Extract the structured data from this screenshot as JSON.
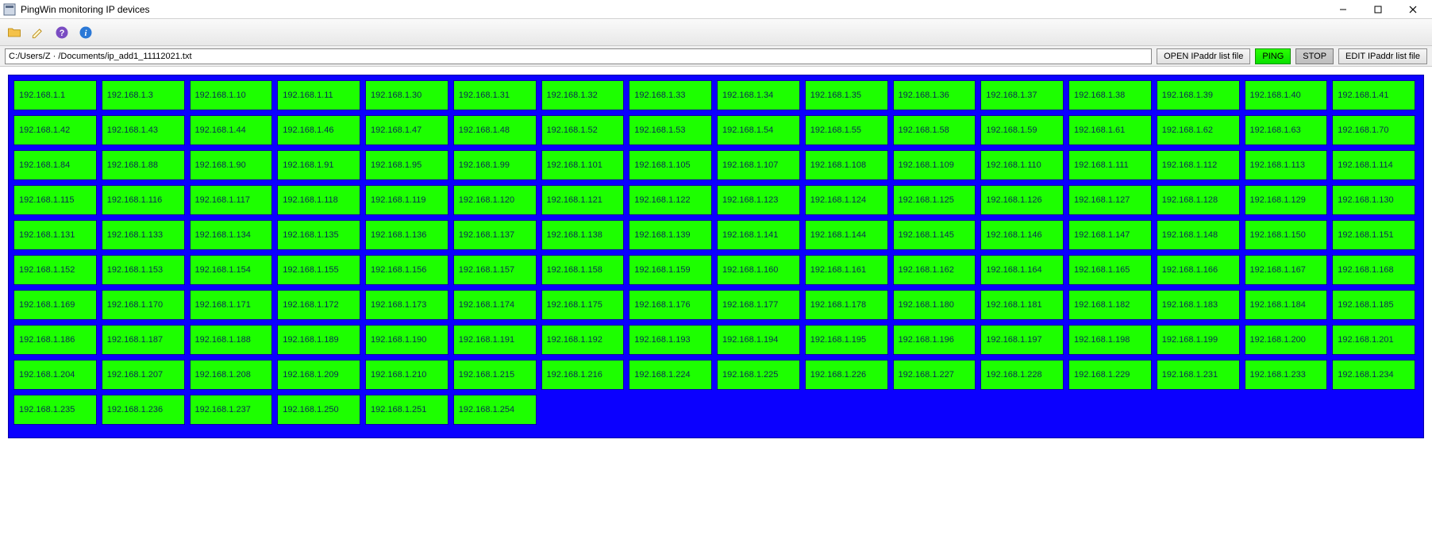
{
  "window": {
    "title": "PingWin monitoring IP devices"
  },
  "toolbar": {
    "icons": [
      "folder-icon",
      "edit-icon",
      "help-icon",
      "info-icon"
    ]
  },
  "pathrow": {
    "path": "C:/Users/Z · /Documents/ip_add1_11112021.txt",
    "open_label": "OPEN IPaddr list file",
    "ping_label": "PING",
    "stop_label": "STOP",
    "edit_label": "EDIT IPaddr list file"
  },
  "ips": [
    "192.168.1.1",
    "192.168.1.3",
    "192.168.1.10",
    "192.168.1.11",
    "192.168.1.30",
    "192.168.1.31",
    "192.168.1.32",
    "192.168.1.33",
    "192.168.1.34",
    "192.168.1.35",
    "192.168.1.36",
    "192.168.1.37",
    "192.168.1.38",
    "192.168.1.39",
    "192.168.1.40",
    "192.168.1.41",
    "192.168.1.42",
    "192.168.1.43",
    "192.168.1.44",
    "192.168.1.46",
    "192.168.1.47",
    "192.168.1.48",
    "192.168.1.52",
    "192.168.1.53",
    "192.168.1.54",
    "192.168.1.55",
    "192.168.1.58",
    "192.168.1.59",
    "192.168.1.61",
    "192.168.1.62",
    "192.168.1.63",
    "192.168.1.70",
    "192.168.1.84",
    "192.168.1.88",
    "192.168.1.90",
    "192.168.1.91",
    "192.168.1.95",
    "192.168.1.99",
    "192.168.1.101",
    "192.168.1.105",
    "192.168.1.107",
    "192.168.1.108",
    "192.168.1.109",
    "192.168.1.110",
    "192.168.1.111",
    "192.168.1.112",
    "192.168.1.113",
    "192.168.1.114",
    "192.168.1.115",
    "192.168.1.116",
    "192.168.1.117",
    "192.168.1.118",
    "192.168.1.119",
    "192.168.1.120",
    "192.168.1.121",
    "192.168.1.122",
    "192.168.1.123",
    "192.168.1.124",
    "192.168.1.125",
    "192.168.1.126",
    "192.168.1.127",
    "192.168.1.128",
    "192.168.1.129",
    "192.168.1.130",
    "192.168.1.131",
    "192.168.1.133",
    "192.168.1.134",
    "192.168.1.135",
    "192.168.1.136",
    "192.168.1.137",
    "192.168.1.138",
    "192.168.1.139",
    "192.168.1.141",
    "192.168.1.144",
    "192.168.1.145",
    "192.168.1.146",
    "192.168.1.147",
    "192.168.1.148",
    "192.168.1.150",
    "192.168.1.151",
    "192.168.1.152",
    "192.168.1.153",
    "192.168.1.154",
    "192.168.1.155",
    "192.168.1.156",
    "192.168.1.157",
    "192.168.1.158",
    "192.168.1.159",
    "192.168.1.160",
    "192.168.1.161",
    "192.168.1.162",
    "192.168.1.164",
    "192.168.1.165",
    "192.168.1.166",
    "192.168.1.167",
    "192.168.1.168",
    "192.168.1.169",
    "192.168.1.170",
    "192.168.1.171",
    "192.168.1.172",
    "192.168.1.173",
    "192.168.1.174",
    "192.168.1.175",
    "192.168.1.176",
    "192.168.1.177",
    "192.168.1.178",
    "192.168.1.180",
    "192.168.1.181",
    "192.168.1.182",
    "192.168.1.183",
    "192.168.1.184",
    "192.168.1.185",
    "192.168.1.186",
    "192.168.1.187",
    "192.168.1.188",
    "192.168.1.189",
    "192.168.1.190",
    "192.168.1.191",
    "192.168.1.192",
    "192.168.1.193",
    "192.168.1.194",
    "192.168.1.195",
    "192.168.1.196",
    "192.168.1.197",
    "192.168.1.198",
    "192.168.1.199",
    "192.168.1.200",
    "192.168.1.201",
    "192.168.1.204",
    "192.168.1.207",
    "192.168.1.208",
    "192.168.1.209",
    "192.168.1.210",
    "192.168.1.215",
    "192.168.1.216",
    "192.168.1.224",
    "192.168.1.225",
    "192.168.1.226",
    "192.168.1.227",
    "192.168.1.228",
    "192.168.1.229",
    "192.168.1.231",
    "192.168.1.233",
    "192.168.1.234",
    "192.168.1.235",
    "192.168.1.236",
    "192.168.1.237",
    "192.168.1.250",
    "192.168.1.251",
    "192.168.1.254"
  ]
}
